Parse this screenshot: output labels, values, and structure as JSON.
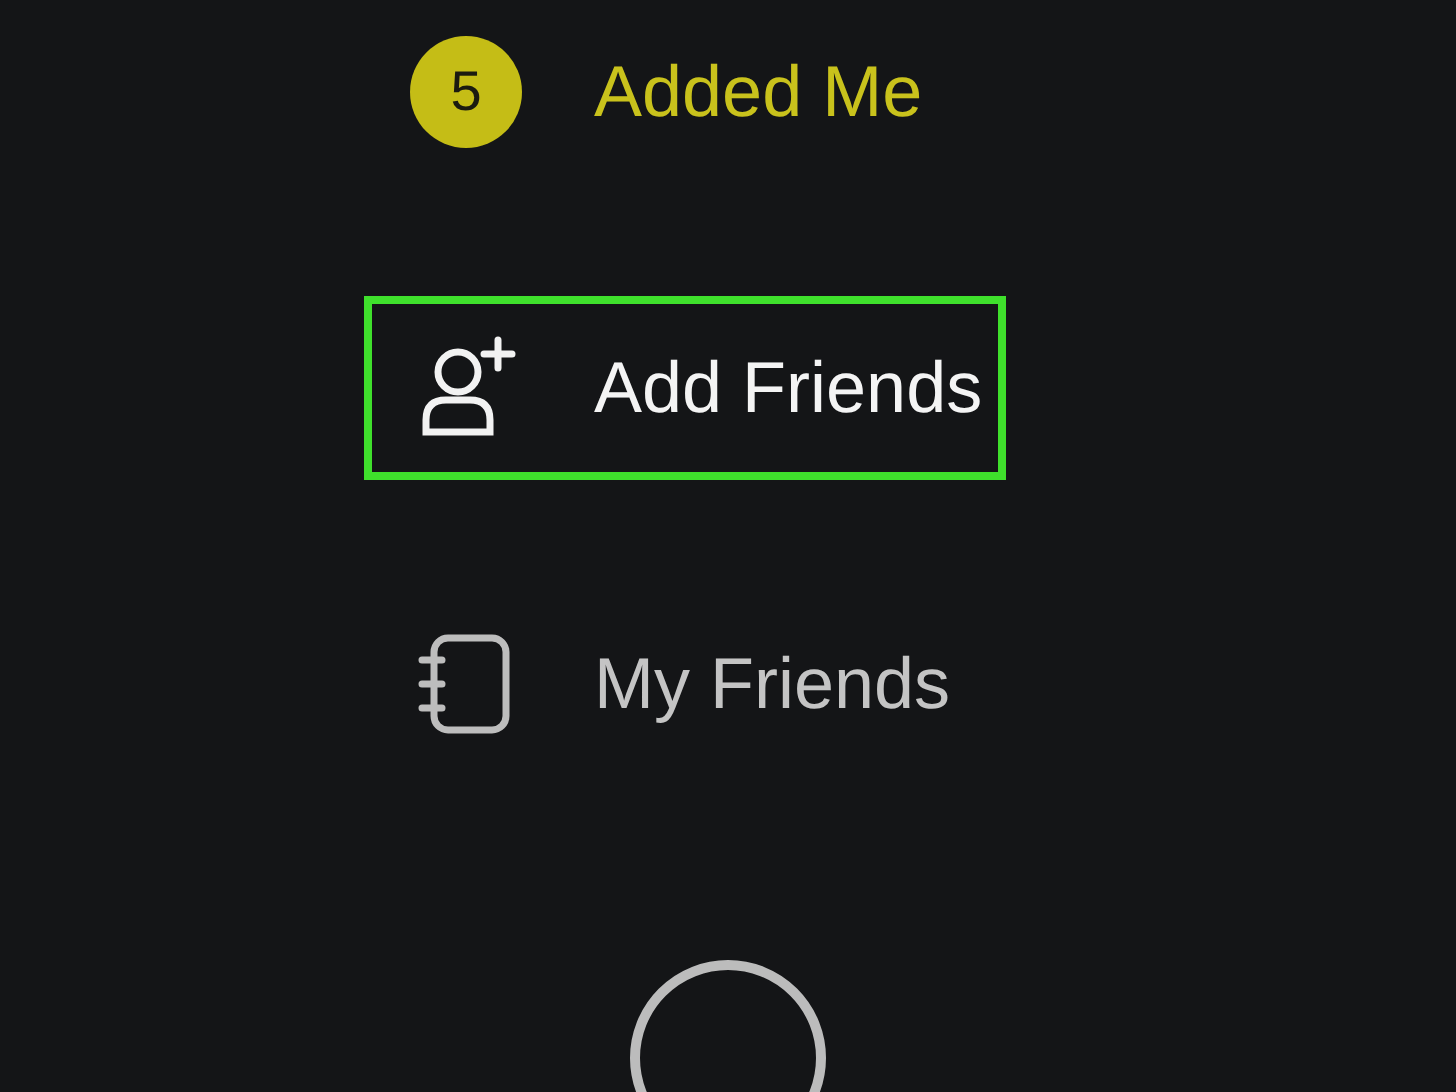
{
  "menu": [
    {
      "kind": "badge",
      "badge": "5",
      "label": "Added Me",
      "highlighted": false
    },
    {
      "kind": "add-friend",
      "label": "Add Friends",
      "highlighted": true
    },
    {
      "kind": "friends-list",
      "label": "My Friends",
      "highlighted": false
    }
  ]
}
